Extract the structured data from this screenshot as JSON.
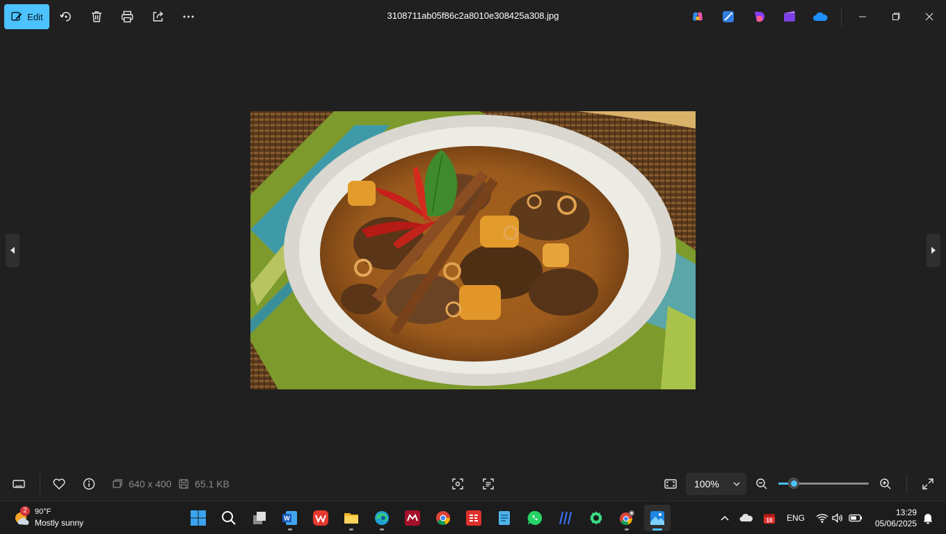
{
  "toolbar": {
    "edit_label": "Edit",
    "icons": [
      "rotate-icon",
      "delete-icon",
      "print-icon",
      "share-icon",
      "more-icon"
    ]
  },
  "file": {
    "title": "3108711ab05f86c2a8010e308425a308.jpg"
  },
  "header_apps": [
    "copilot-icon",
    "designer-icon",
    "clipchamp-icon",
    "video-editor-icon",
    "onedrive-icon"
  ],
  "image": {
    "description_icon": "curry-dish-photo"
  },
  "bottom": {
    "dimensions": "640 x 400",
    "file_size": "65.1 KB",
    "zoom_value": "100%",
    "zoom_slider_fraction": 0.17
  },
  "taskbar": {
    "weather_temp": "90°F",
    "weather_desc": "Mostly sunny",
    "weather_badge": "2",
    "apps": [
      "start",
      "search",
      "task-view",
      "word",
      "wps",
      "file-explorer",
      "edge",
      "mendeley",
      "chrome",
      "sejda",
      "notepad",
      "whatsapp",
      "vscode-like",
      "android-studio",
      "chrome-profile",
      "photos"
    ],
    "language": "ENG",
    "calendar_badge": "10",
    "time": "13:29",
    "date": "05/06/2025"
  },
  "colors": {
    "accent": "#4cc2ff",
    "background": "#202020",
    "taskbar": "#1c1c1c"
  }
}
